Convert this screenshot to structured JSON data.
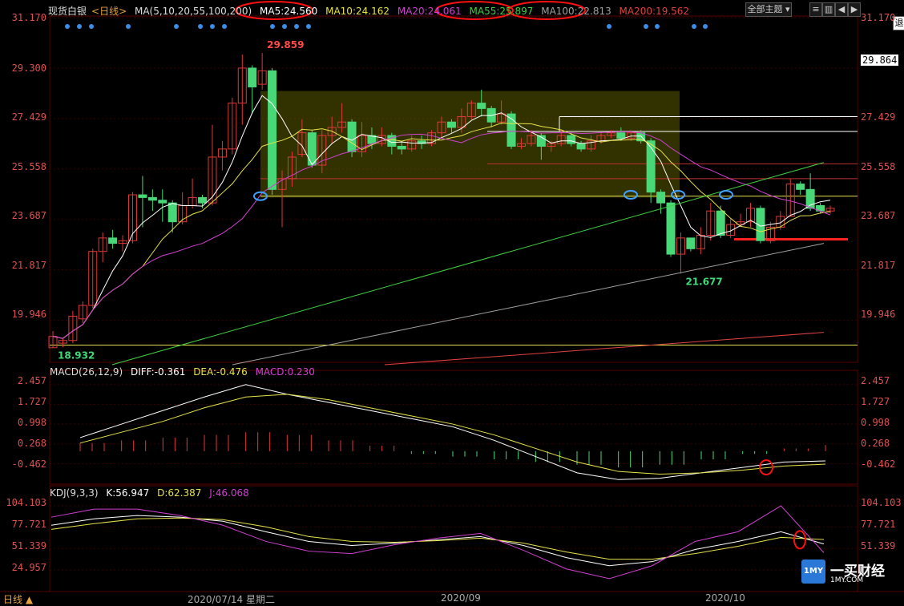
{
  "header": {
    "instrument": "现货白银",
    "period": "<日线>",
    "ma_params": "MA(5,10,20,55,100,200)",
    "ma": [
      {
        "label": "MA5:24.560",
        "color": "#ffffff"
      },
      {
        "label": "MA10:24.162",
        "color": "#e6e24a"
      },
      {
        "label": "MA20:24.061",
        "color": "#d040d0"
      },
      {
        "label": "MA55:25.897",
        "color": "#40d040"
      },
      {
        "label": "MA100:22.813",
        "color": "#a0a0a0"
      },
      {
        "label": "MA200:19.562",
        "color": "#e04040"
      }
    ],
    "theme_button": "全部主题",
    "icons": [
      "menu-icon",
      "split-icon",
      "back-icon",
      "forward-icon"
    ],
    "exit_button": "退"
  },
  "price_axis": {
    "labels_left": [
      "31.170",
      "29.300",
      "27.429",
      "25.558",
      "23.687",
      "21.817",
      "19.946"
    ],
    "labels_right": [
      "31.170",
      "29.864",
      "27.429",
      "25.558",
      "23.687",
      "21.817",
      "19.946"
    ],
    "ylim": [
      18.3,
      31.17
    ]
  },
  "macd_panel": {
    "params": "MACD(26,12,9)",
    "diff": "DIFF:-0.361",
    "dea": "DEA:-0.476",
    "macd": "MACD:0.230",
    "axis_labels": [
      "2.457",
      "1.727",
      "0.998",
      "0.268",
      "-0.462"
    ]
  },
  "kdj_panel": {
    "params": "KDJ(9,3,3)",
    "k": "K:56.947",
    "d": "D:62.387",
    "j": "J:46.068",
    "axis_labels": [
      "104.103",
      "77.721",
      "51.339",
      "24.957"
    ]
  },
  "date_axis": {
    "period_label": "日线",
    "labels": [
      "2020/07/14 星期二",
      "2020/09",
      "2020/10"
    ]
  },
  "logo": {
    "text": "一买财经",
    "url": "1MY.COM",
    "badge": "1MY"
  },
  "colors": {
    "up": "#e03838",
    "down": "#48d878",
    "bg": "#000000",
    "grid": "#3a0000"
  },
  "chart_data": [
    {
      "type": "candlestick",
      "title": "现货白银 <日线>",
      "ylim": [
        18.3,
        31.17
      ],
      "candles": [
        [
          18.93,
          19.35,
          19.55,
          18.93
        ],
        [
          19.1,
          19.2,
          19.3,
          18.95
        ],
        [
          19.2,
          20.1,
          20.3,
          19.1
        ],
        [
          20.0,
          20.5,
          20.65,
          19.85
        ],
        [
          20.5,
          22.5,
          22.6,
          20.4
        ],
        [
          22.5,
          23.0,
          23.2,
          22.1
        ],
        [
          23.0,
          22.8,
          23.3,
          22.6
        ],
        [
          22.8,
          22.9,
          23.1,
          22.5
        ],
        [
          22.9,
          24.6,
          24.7,
          22.8
        ],
        [
          24.6,
          24.5,
          25.3,
          23.4
        ],
        [
          24.5,
          24.4,
          24.8,
          24.0
        ],
        [
          24.4,
          24.3,
          24.8,
          23.6
        ],
        [
          24.3,
          23.6,
          24.4,
          23.2
        ],
        [
          23.6,
          24.2,
          24.7,
          23.5
        ],
        [
          24.2,
          24.5,
          25.2,
          24.1
        ],
        [
          24.5,
          24.3,
          24.6,
          24.1
        ],
        [
          24.3,
          26.0,
          27.2,
          24.2
        ],
        [
          26.0,
          26.3,
          26.6,
          25.5
        ],
        [
          26.3,
          28.0,
          28.2,
          26.1
        ],
        [
          28.0,
          29.3,
          29.8,
          27.2
        ],
        [
          29.3,
          28.6,
          29.4,
          27.6
        ],
        [
          28.7,
          29.2,
          29.859,
          28.5
        ],
        [
          29.2,
          24.8,
          29.3,
          24.6
        ],
        [
          24.8,
          25.2,
          25.5,
          23.4
        ],
        [
          25.2,
          26.0,
          26.2,
          24.9
        ],
        [
          26.1,
          26.9,
          27.4,
          26.0
        ],
        [
          26.9,
          25.7,
          27.0,
          25.6
        ],
        [
          25.7,
          26.8,
          27.0,
          25.4
        ],
        [
          26.8,
          27.1,
          27.5,
          26.5
        ],
        [
          27.1,
          27.3,
          28.0,
          26.9
        ],
        [
          27.3,
          26.2,
          27.4,
          26.0
        ],
        [
          26.2,
          26.8,
          27.3,
          26.0
        ],
        [
          26.8,
          26.5,
          27.1,
          26.3
        ],
        [
          26.5,
          26.8,
          27.1,
          26.4
        ],
        [
          26.8,
          26.4,
          26.9,
          26.1
        ],
        [
          26.4,
          26.3,
          26.6,
          26.1
        ],
        [
          26.3,
          26.6,
          26.8,
          26.2
        ],
        [
          26.6,
          26.5,
          26.8,
          26.3
        ],
        [
          26.5,
          26.9,
          27.0,
          26.4
        ],
        [
          26.9,
          27.3,
          27.5,
          26.7
        ],
        [
          27.3,
          27.1,
          27.4,
          26.9
        ],
        [
          27.1,
          27.5,
          27.8,
          26.9
        ],
        [
          27.5,
          28.0,
          28.1,
          27.4
        ],
        [
          28.0,
          27.8,
          28.5,
          27.5
        ],
        [
          27.8,
          27.3,
          27.9,
          27.1
        ],
        [
          27.3,
          27.6,
          28.1,
          27.2
        ],
        [
          27.6,
          26.4,
          27.7,
          26.3
        ],
        [
          26.4,
          26.5,
          26.7,
          26.3
        ],
        [
          26.5,
          26.8,
          27.0,
          26.4
        ],
        [
          26.8,
          26.4,
          26.9,
          25.9
        ],
        [
          26.4,
          26.5,
          26.6,
          26.2
        ],
        [
          26.5,
          26.8,
          27.0,
          26.4
        ],
        [
          26.8,
          26.5,
          26.9,
          26.4
        ],
        [
          26.5,
          26.3,
          26.6,
          26.2
        ],
        [
          26.3,
          26.6,
          26.8,
          26.2
        ],
        [
          26.6,
          26.8,
          26.9,
          26.5
        ],
        [
          26.8,
          26.9,
          27.0,
          26.7
        ],
        [
          26.9,
          26.7,
          27.1,
          26.6
        ],
        [
          26.7,
          26.9,
          27.0,
          26.6
        ],
        [
          26.9,
          26.6,
          27.0,
          26.5
        ],
        [
          26.6,
          24.7,
          26.7,
          24.3
        ],
        [
          24.7,
          24.3,
          24.8,
          23.9
        ],
        [
          24.3,
          22.4,
          24.4,
          22.3
        ],
        [
          22.4,
          23.0,
          23.2,
          21.677
        ],
        [
          23.0,
          22.6,
          23.0,
          22.5
        ],
        [
          22.6,
          23.1,
          23.4,
          22.4
        ],
        [
          23.1,
          24.0,
          24.3,
          22.9
        ],
        [
          24.0,
          23.1,
          24.2,
          23.0
        ],
        [
          23.1,
          23.5,
          23.7,
          23.0
        ],
        [
          23.5,
          23.6,
          23.9,
          23.4
        ],
        [
          23.6,
          24.1,
          24.3,
          23.4
        ],
        [
          24.1,
          22.9,
          24.2,
          22.8
        ],
        [
          22.9,
          23.4,
          23.6,
          22.8
        ],
        [
          23.4,
          23.8,
          24.0,
          23.3
        ],
        [
          23.8,
          25.0,
          25.2,
          23.8
        ],
        [
          25.0,
          24.8,
          25.1,
          24.6
        ],
        [
          24.8,
          24.1,
          25.4,
          24.0
        ],
        [
          24.2,
          24.0,
          24.3,
          23.9
        ],
        [
          24.0,
          24.1,
          24.2,
          23.9
        ]
      ],
      "annotations": [
        {
          "text": "29.859",
          "value": 29.859,
          "color": "#ff4a4a"
        },
        {
          "text": "21.677",
          "value": 21.677,
          "color": "#40d878"
        },
        {
          "text": "18.932",
          "value": 18.932,
          "color": "#40d878"
        }
      ]
    },
    {
      "type": "line",
      "title": "MACD(26,12,9)",
      "series": [
        {
          "name": "DIFF",
          "color": "#ffffff",
          "values": [
            0.5,
            1.0,
            1.5,
            2.0,
            2.46,
            2.1,
            1.8,
            1.5,
            1.2,
            0.9,
            0.4,
            -0.2,
            -0.8,
            -1.05,
            -1.0,
            -0.8,
            -0.6,
            -0.4,
            -0.36
          ]
        },
        {
          "name": "DEA",
          "color": "#e6e24a",
          "values": [
            0.3,
            0.7,
            1.1,
            1.6,
            2.0,
            2.1,
            1.9,
            1.6,
            1.3,
            1.0,
            0.6,
            0.1,
            -0.4,
            -0.75,
            -0.85,
            -0.8,
            -0.7,
            -0.55,
            -0.48
          ]
        }
      ],
      "histogram": [
        0.3,
        0.4,
        0.5,
        0.6,
        0.7,
        0.6,
        0.4,
        0.2,
        -0.1,
        -0.2,
        -0.3,
        -0.4,
        -0.5,
        -0.6,
        -0.5,
        -0.3,
        -0.1,
        0.1,
        0.23
      ]
    },
    {
      "type": "line",
      "title": "KDJ(9,3,3)",
      "series": [
        {
          "name": "K",
          "color": "#ffffff",
          "values": [
            80,
            88,
            92,
            90,
            85,
            72,
            60,
            55,
            58,
            62,
            66,
            55,
            40,
            30,
            35,
            50,
            60,
            72,
            56.9
          ]
        },
        {
          "name": "D",
          "color": "#e6e24a",
          "values": [
            75,
            82,
            88,
            89,
            87,
            78,
            66,
            60,
            59,
            61,
            64,
            58,
            47,
            38,
            38,
            45,
            54,
            65,
            62.4
          ]
        },
        {
          "name": "J",
          "color": "#d040d0",
          "values": [
            90,
            100,
            100,
            92,
            80,
            60,
            48,
            45,
            56,
            64,
            70,
            49,
            26,
            14,
            30,
            60,
            72,
            104,
            46.1
          ]
        }
      ]
    }
  ]
}
